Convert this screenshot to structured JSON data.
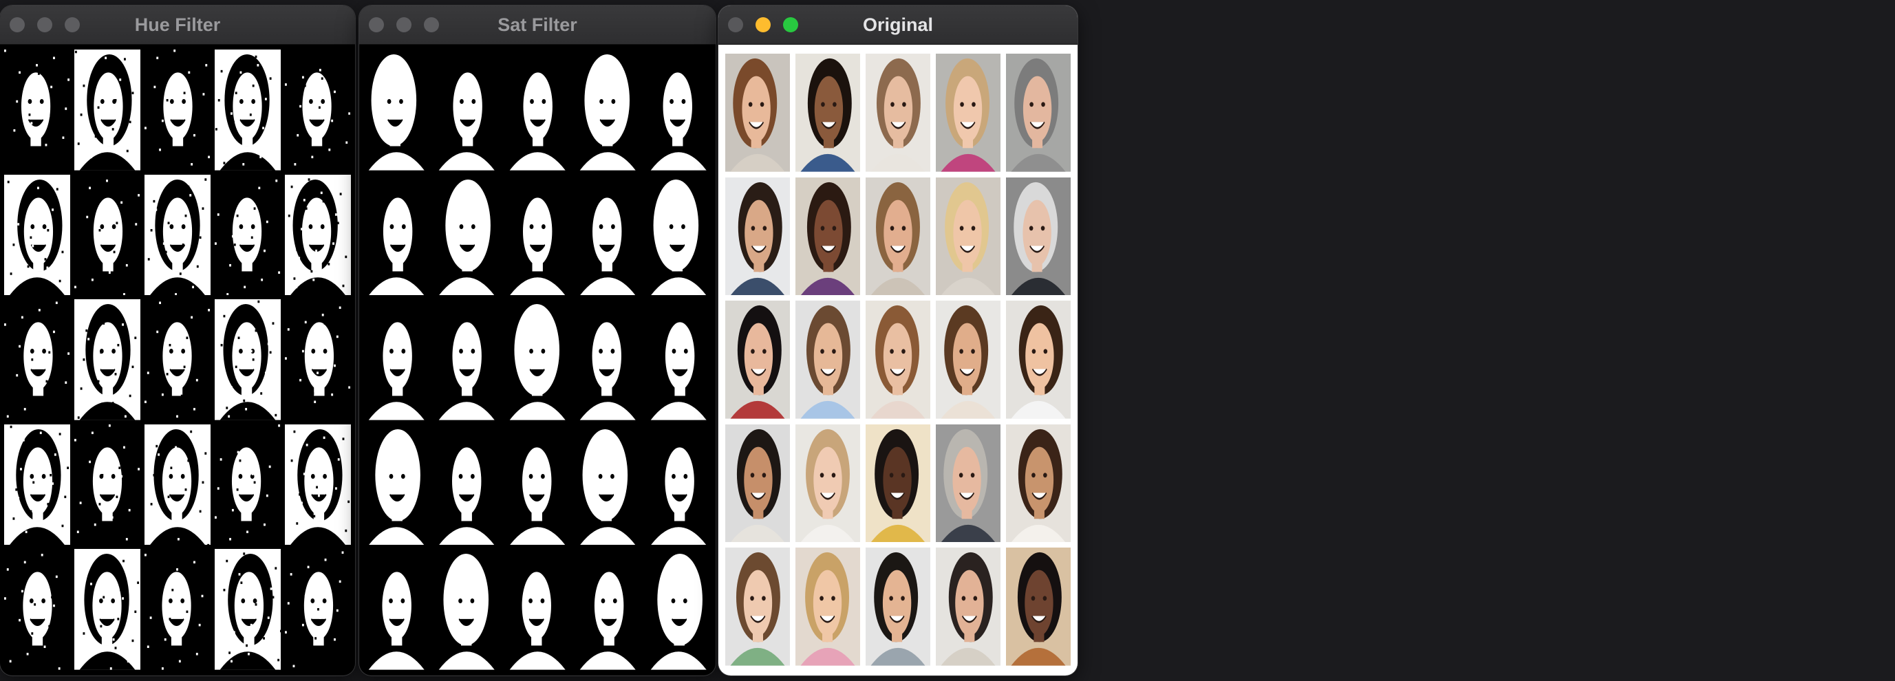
{
  "windows": [
    {
      "id": "hue",
      "title": "Hue Filter",
      "active": false,
      "style": "hue"
    },
    {
      "id": "sat",
      "title": "Sat Filter",
      "active": false,
      "style": "sat"
    },
    {
      "id": "orig",
      "title": "Original",
      "active": true,
      "style": "orig"
    }
  ],
  "grid": {
    "rows": 5,
    "cols": 5
  },
  "colors": {
    "skin": [
      "#e8b99a",
      "#8a5a3c",
      "#e6bca0",
      "#f0c8ad",
      "#e3b79f",
      "#d9a887",
      "#7c4a33",
      "#e2ae8f",
      "#efc6a8",
      "#e7c2ac",
      "#e8b89c",
      "#e6b897",
      "#e9bfa2",
      "#e0ad8a",
      "#efc2a1",
      "#c68f6a",
      "#f0cbb3",
      "#5a3524",
      "#e6b9a0",
      "#c8946d",
      "#efcab0",
      "#f0c7a6",
      "#e4b493",
      "#e2b296",
      "#6e4330"
    ],
    "hair": [
      "#7a4a2b",
      "#1b120d",
      "#8d6a4e",
      "#c9a77a",
      "#7c7c7c",
      "#2a1d16",
      "#2b1a12",
      "#8a6440",
      "#e1c78f",
      "#d9d9d9",
      "#141011",
      "#6b4a32",
      "#8a5a36",
      "#5b3a22",
      "#3a2416",
      "#1d1714",
      "#c8a57a",
      "#1a1412",
      "#b9b6b0",
      "#3b2418",
      "#6c4a30",
      "#c9a267",
      "#1b1714",
      "#2a2220",
      "#151010"
    ],
    "bg": [
      "#c9c4bd",
      "#e6e3dc",
      "#e9e6e1",
      "#b7b6b2",
      "#a6a7a5",
      "#e7e8ea",
      "#d6cfc4",
      "#d7d3cd",
      "#cfc9c1",
      "#8b8b8b",
      "#d9d7d2",
      "#e1e1e1",
      "#e8e4dd",
      "#e8e7e4",
      "#e4e2de",
      "#dcdcdc",
      "#e9e7e2",
      "#efe2c7",
      "#9a9a9a",
      "#e6e2dc",
      "#e2e2e2",
      "#e3d9cf",
      "#e4e4e4",
      "#e5e3df",
      "#d9c1a2"
    ],
    "shirt": [
      "#d6cfc5",
      "#3a5b8c",
      "#e9e5df",
      "#c0457e",
      "#8f8f8f",
      "#3b4e6b",
      "#6b3f7c",
      "#ccc3b7",
      "#d9d3cb",
      "#2a2d33",
      "#b33a3a",
      "#a8c5e6",
      "#e8d7ce",
      "#ebe1d6",
      "#f4f4f4",
      "#e6e3dd",
      "#f3f1ee",
      "#e1b84a",
      "#3a3f4a",
      "#f4f1ec",
      "#7fb084",
      "#e7a3b8",
      "#9aa5ae",
      "#d6d0c6",
      "#b5703b"
    ]
  }
}
